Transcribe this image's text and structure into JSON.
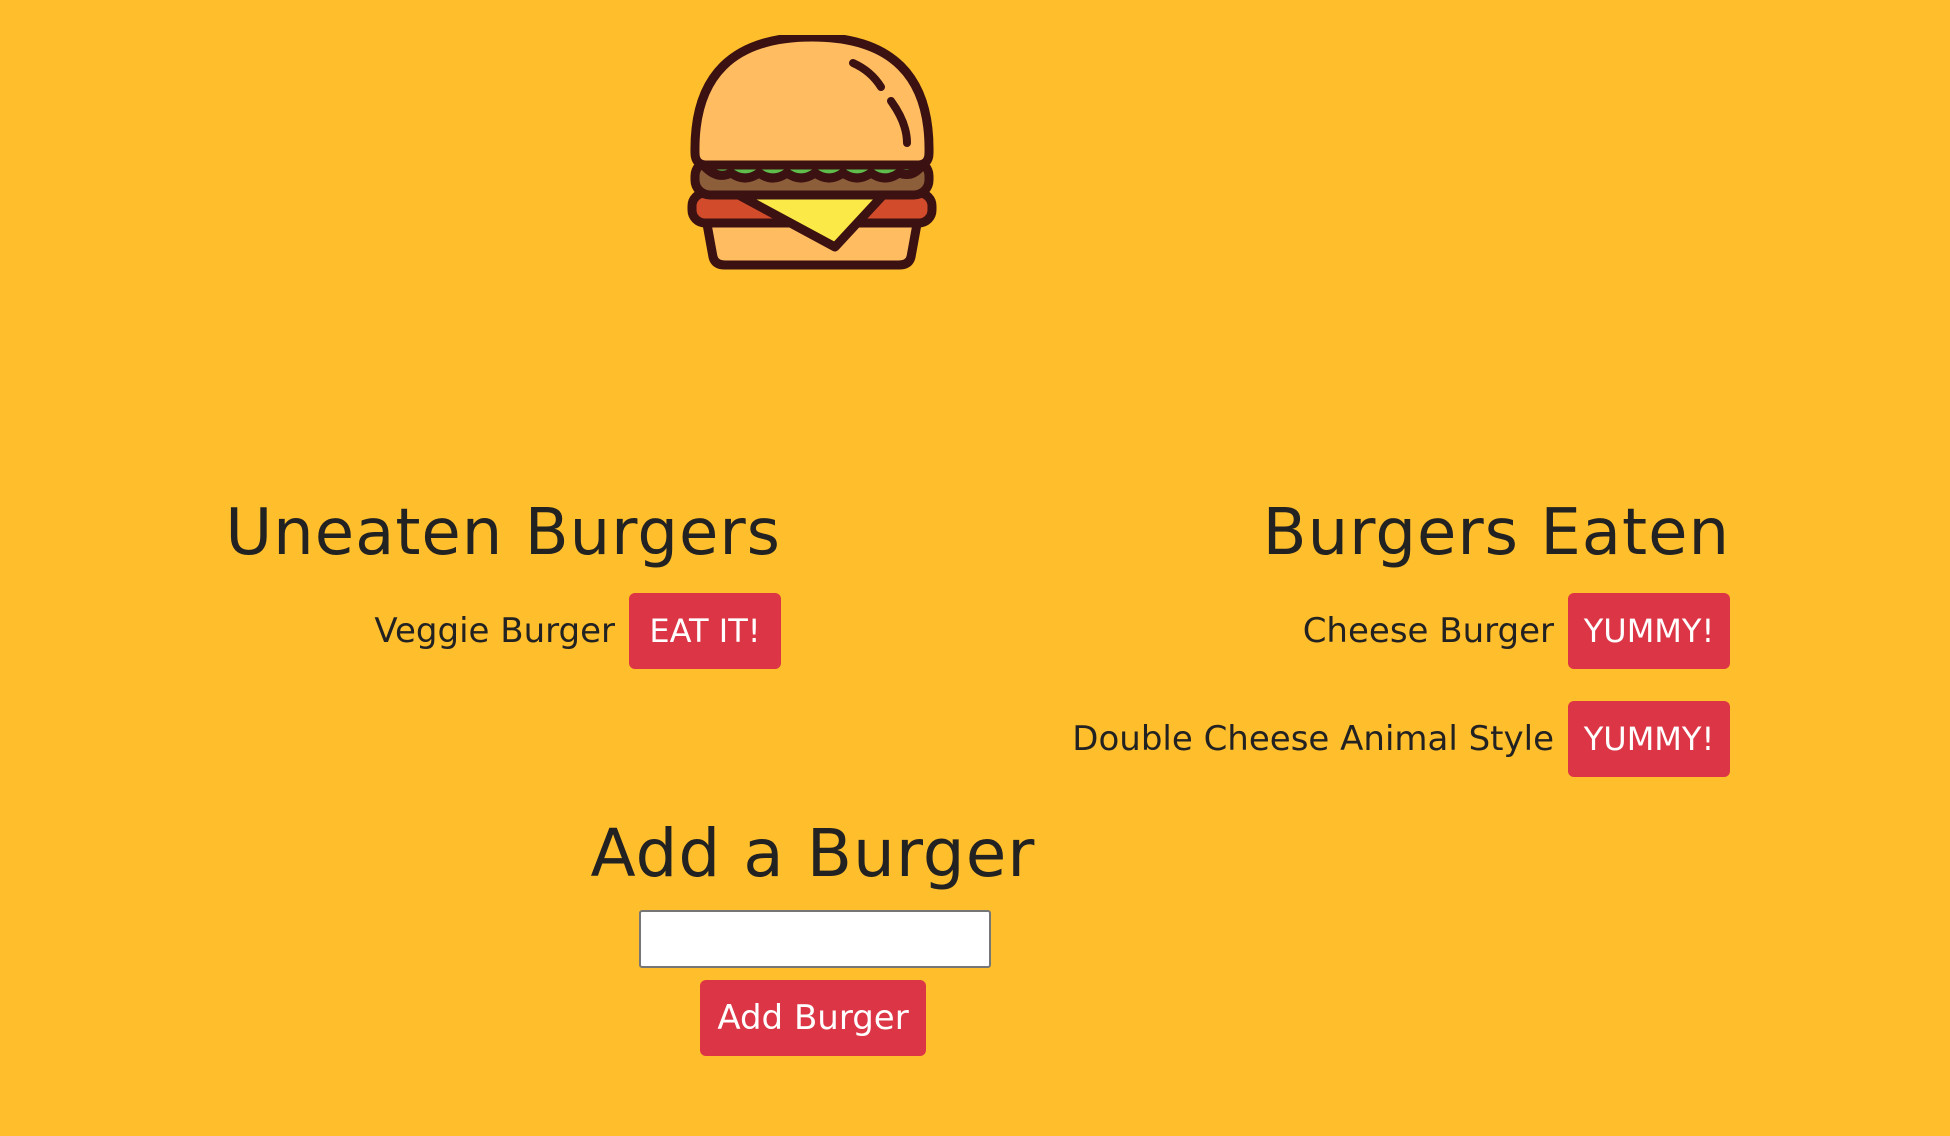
{
  "logo": {
    "icon": "hamburger-icon"
  },
  "uneaten": {
    "title": "Uneaten Burgers",
    "items": [
      {
        "name": "Veggie Burger",
        "button_label": "EAT IT!"
      }
    ]
  },
  "eaten": {
    "title": "Burgers Eaten",
    "items": [
      {
        "name": "Cheese Burger",
        "button_label": "YUMMY!"
      },
      {
        "name": "Double Cheese Animal Style",
        "button_label": "YUMMY!"
      }
    ]
  },
  "add_form": {
    "title": "Add a Burger",
    "input_value": "",
    "button_label": "Add Burger"
  },
  "colors": {
    "background": "#ffbe2b",
    "button": "#dc3545",
    "text": "#222222"
  }
}
